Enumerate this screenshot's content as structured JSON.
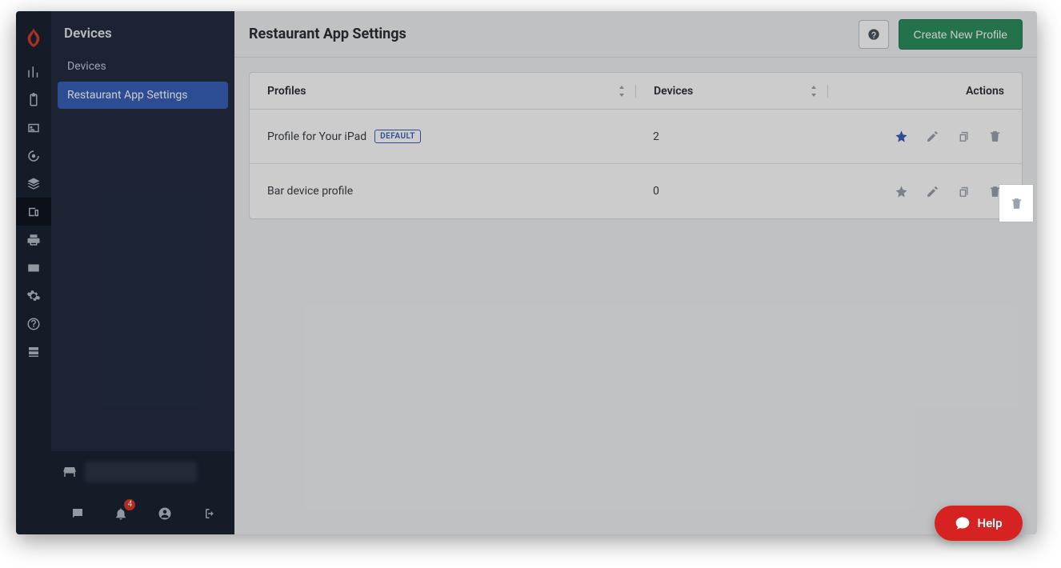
{
  "sidebar": {
    "title": "Devices",
    "items": [
      {
        "label": "Devices",
        "active": false
      },
      {
        "label": "Restaurant App Settings",
        "active": true
      }
    ]
  },
  "header": {
    "title": "Restaurant App Settings",
    "create_label": "Create New Profile"
  },
  "table": {
    "columns": {
      "profiles": "Profiles",
      "devices": "Devices",
      "actions": "Actions"
    },
    "default_badge": "DEFAULT",
    "rows": [
      {
        "name": "Profile for Your iPad",
        "devices": "2",
        "is_default": true
      },
      {
        "name": "Bar device profile",
        "devices": "0",
        "is_default": false
      }
    ]
  },
  "footer": {
    "notification_count": "4"
  },
  "help_fab": {
    "label": "Help"
  }
}
